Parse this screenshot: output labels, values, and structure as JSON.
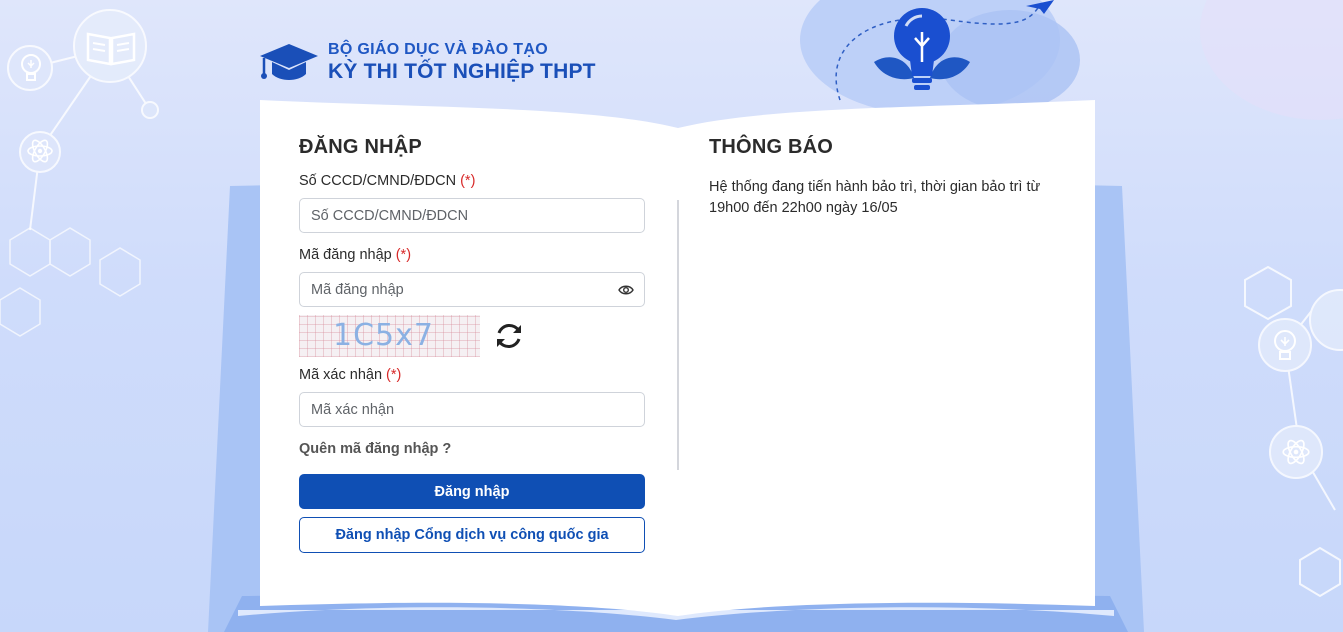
{
  "header": {
    "line1": "BỘ GIÁO DỤC VÀ ĐÀO TẠO",
    "line2": "KỲ THI TỐT NGHIỆP THPT"
  },
  "login": {
    "title": "ĐĂNG NHẬP",
    "id_label": "Số CCCD/CMND/ĐDCN",
    "id_placeholder": "Số CCCD/CMND/ĐDCN",
    "password_label": "Mã đăng nhập",
    "password_placeholder": "Mã đăng nhập",
    "captcha_text": "1C5x7",
    "captcha_label": "Mã xác nhận",
    "captcha_placeholder": "Mã xác nhận",
    "required_mark": "(*)",
    "forgot_link": "Quên mã đăng nhập ?",
    "login_button": "Đăng nhập",
    "national_portal_button": "Đăng nhập Cổng dịch vụ công quốc gia"
  },
  "notice": {
    "title": "THÔNG BÁO",
    "body": "Hệ thống đang tiến hành bảo trì, thời gian bảo trì từ 19h00 đến 22h00 ngày 16/05"
  },
  "colors": {
    "primary": "#0f4fb4",
    "brand_text": "#1a4fb8",
    "required": "#d82a2a",
    "background": "#cfdcfb"
  },
  "icons": [
    "graduation-cap-icon",
    "eye-icon",
    "refresh-icon",
    "lightbulb-icon",
    "paper-plane-icon",
    "book-icon",
    "atom-icon"
  ]
}
